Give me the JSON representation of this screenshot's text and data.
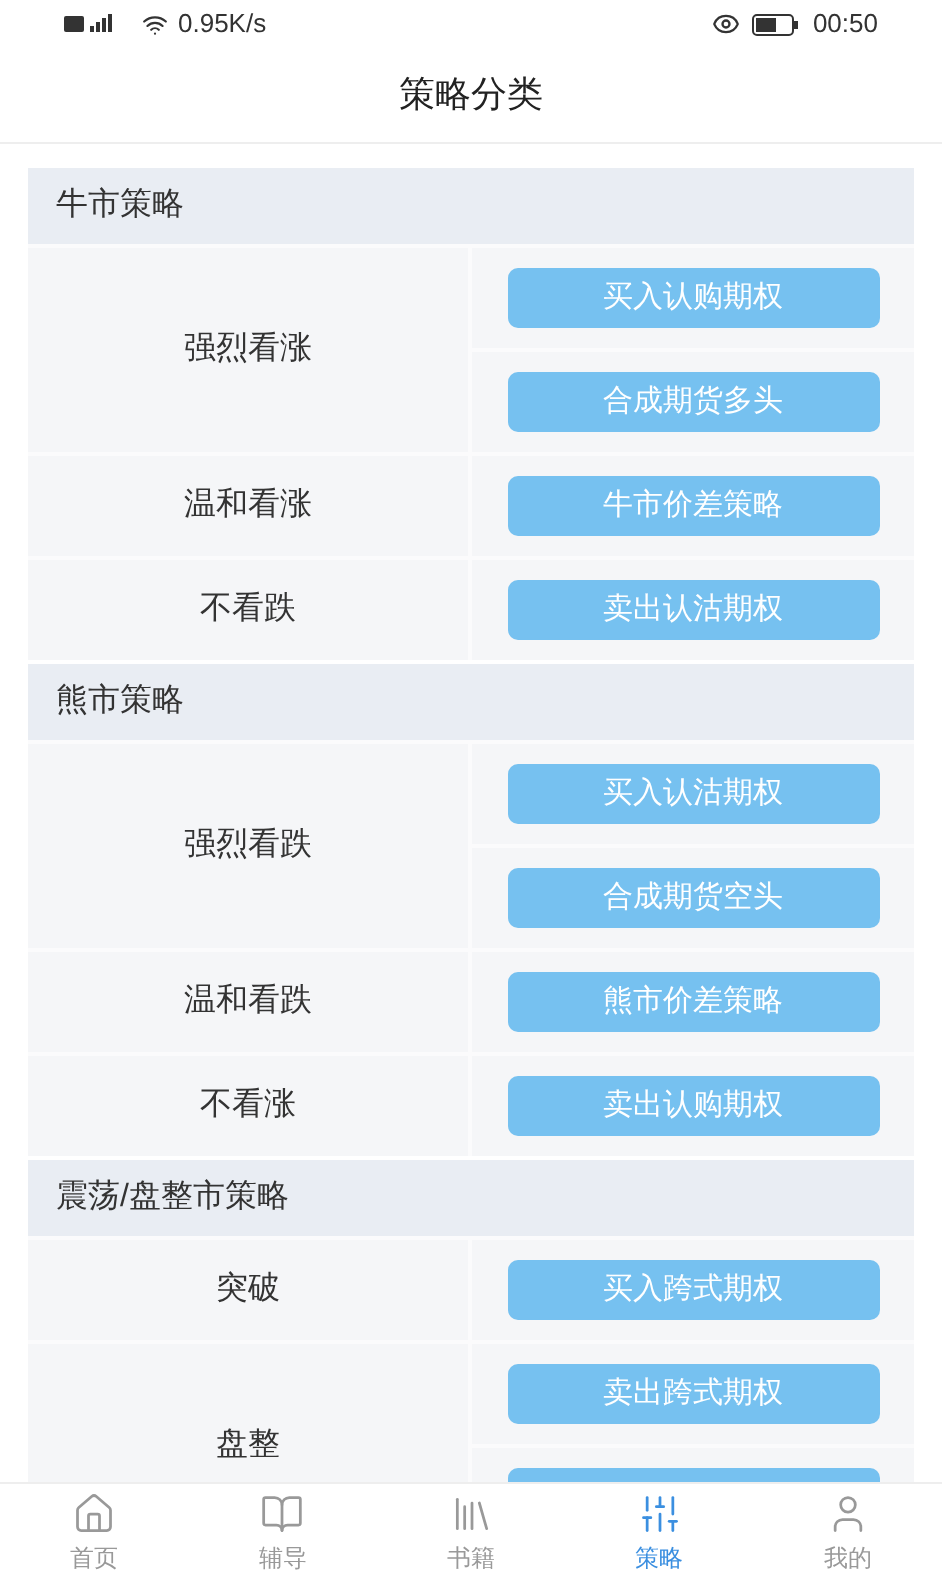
{
  "status_bar": {
    "speed": "0.95K/s",
    "time": "00:50"
  },
  "title": "策略分类",
  "sections": [
    {
      "title": "牛市策略",
      "rows": [
        {
          "label": "强烈看涨",
          "buttons": [
            {
              "kind": "full",
              "label": "买入认购期权"
            },
            {
              "kind": "full",
              "label": "合成期货多头"
            }
          ]
        },
        {
          "label": "温和看涨",
          "buttons": [
            {
              "kind": "full",
              "label": "牛市价差策略"
            }
          ]
        },
        {
          "label": "不看跌",
          "buttons": [
            {
              "kind": "full",
              "label": "卖出认沽期权"
            }
          ]
        }
      ]
    },
    {
      "title": "熊市策略",
      "rows": [
        {
          "label": "强烈看跌",
          "buttons": [
            {
              "kind": "full",
              "label": "买入认沽期权"
            },
            {
              "kind": "full",
              "label": "合成期货空头"
            }
          ]
        },
        {
          "label": "温和看跌",
          "buttons": [
            {
              "kind": "full",
              "label": "熊市价差策略"
            }
          ]
        },
        {
          "label": "不看涨",
          "buttons": [
            {
              "kind": "full",
              "label": "卖出认购期权"
            }
          ]
        }
      ]
    },
    {
      "title": "震荡/盘整市策略",
      "rows": [
        {
          "label": "突破",
          "buttons": [
            {
              "kind": "full",
              "label": "买入跨式期权"
            }
          ]
        },
        {
          "label": "盘整",
          "buttons": [
            {
              "kind": "full",
              "label": "卖出跨式期权"
            },
            {
              "kind": "cut"
            }
          ]
        }
      ]
    }
  ],
  "tabs": [
    {
      "label": "首页",
      "selected": false
    },
    {
      "label": "辅导",
      "selected": false
    },
    {
      "label": "书籍",
      "selected": false
    },
    {
      "label": "策略",
      "selected": true
    },
    {
      "label": "我的",
      "selected": false
    }
  ]
}
